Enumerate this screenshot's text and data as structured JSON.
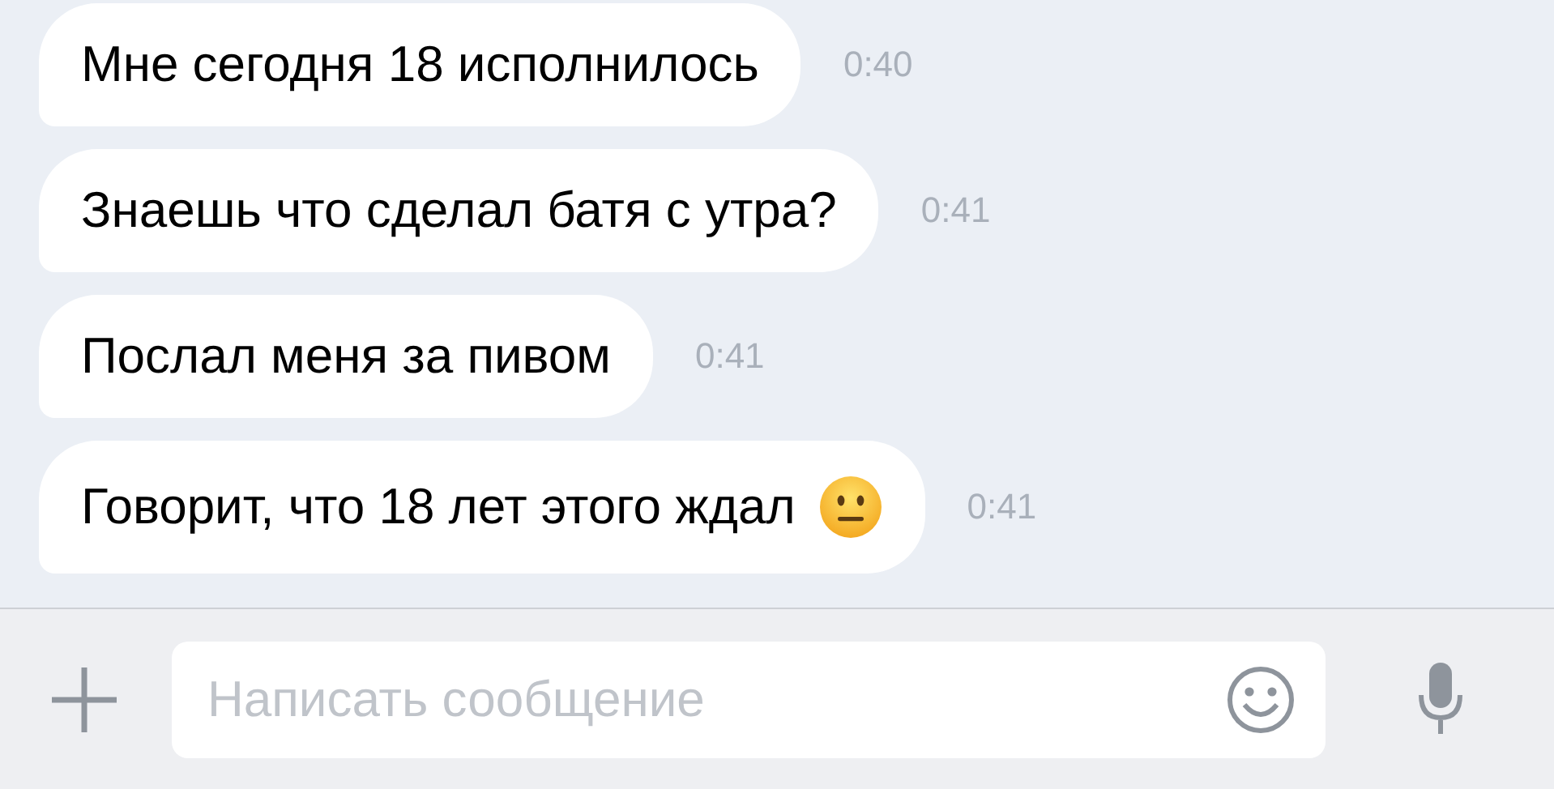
{
  "messages": [
    {
      "text": "Мне сегодня 18 исполнилось",
      "time": "0:40",
      "emoji": false
    },
    {
      "text": "Знаешь что сделал батя с утра?",
      "time": "0:41",
      "emoji": false
    },
    {
      "text": "Послал меня за пивом",
      "time": "0:41",
      "emoji": false
    },
    {
      "text": "Говорит, что 18 лет этого ждал",
      "time": "0:41",
      "emoji": true
    }
  ],
  "composer": {
    "placeholder": "Написать сообщение"
  }
}
